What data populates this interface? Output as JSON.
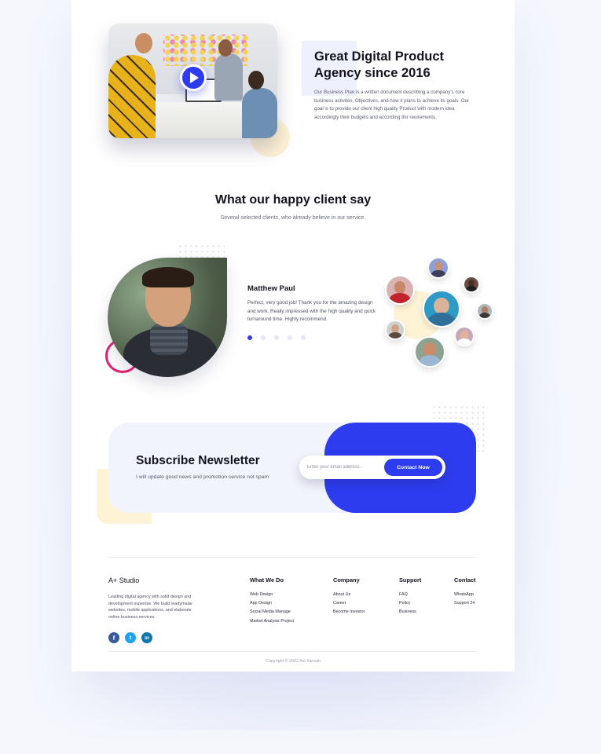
{
  "hero": {
    "title_line1": "Great Digital Product",
    "title_line2": "Agency since 2016",
    "description": "Our Business Plan is a written document describing a company's core business activites, Objectives, and how it plans to achieve its goals. Our goal is to provide our client high quality Product with modern idea accordingly their budgets and according thir reuirements.",
    "video_icon": "play-icon"
  },
  "testimonials": {
    "title": "What our happy client say",
    "subtitle": "Several selected clients, who already believe in our service.",
    "client_name": "Matthew Paul",
    "quote": "Perfect, very good job! Thank you for the amazing design and work. Really impressed with the high quality and quick turnaround time. Highly recommend.",
    "pager_active_index": 0,
    "pager_count": 5
  },
  "newsletter": {
    "title": "Subscribe Newsletter",
    "subtitle": "I will update good news and promotion service not spam",
    "email_placeholder": "Enter your email address..",
    "button_label": "Contact Now"
  },
  "footer": {
    "brand": "A+ Studio",
    "brand_text": "Leading digital agency with solid design and development expertise. We build readymade websites, mobile applications, and elaborate online business services.",
    "columns": [
      {
        "title": "What We Do",
        "links": [
          "Web Design",
          "App Design",
          "Social Media Manage",
          "Market Analysis Project"
        ]
      },
      {
        "title": "Company",
        "links": [
          "About Us",
          "Career",
          "Become Investor"
        ]
      },
      {
        "title": "Support",
        "links": [
          "FAQ",
          "Policy",
          "Business"
        ]
      },
      {
        "title": "Contact",
        "links": [
          "WhatsApp",
          "Support 24"
        ]
      }
    ],
    "socials": [
      {
        "icon": "facebook-icon",
        "glyph": "f"
      },
      {
        "icon": "twitter-icon",
        "glyph": "t"
      },
      {
        "icon": "linkedin-icon",
        "glyph": "in"
      }
    ],
    "copyright": "Copyright © 2022 Avi Yansah"
  },
  "colors": {
    "accent": "#2e3cf0",
    "pink": "#e91e72",
    "soft_yellow": "#fff3d6",
    "soft_blue": "#f1f4fd"
  }
}
